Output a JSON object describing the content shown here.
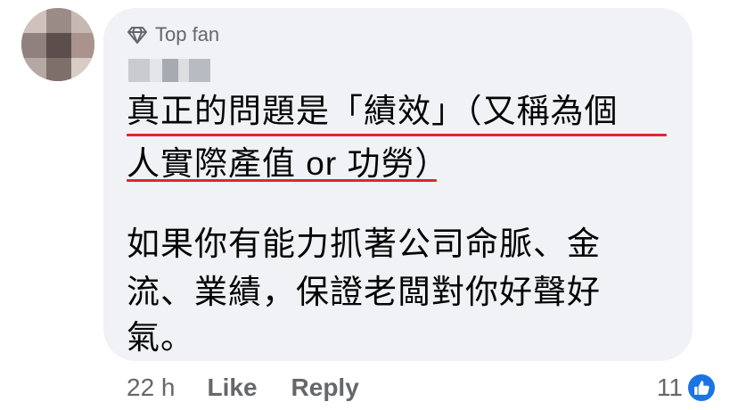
{
  "comment": {
    "badge_label": "Top fan",
    "author_name": "▒▒▒",
    "body_lines": [
      "真正的問題是「績效」（又稱為個",
      "人實際產值 or 功勞）",
      "如果你有能力抓著公司命脈、金",
      "流、業績，保證老闆對你好聲好",
      "氣。"
    ],
    "highlight_color": "#e0282c"
  },
  "footer": {
    "time": "22 h",
    "like_label": "Like",
    "reply_label": "Reply",
    "reaction_count": "11",
    "reaction_icon": "thumbs-up-icon"
  },
  "colors": {
    "bubble": "#f0f2f5",
    "secondary_text": "#65676b",
    "like_blue": "#1b74e4"
  }
}
